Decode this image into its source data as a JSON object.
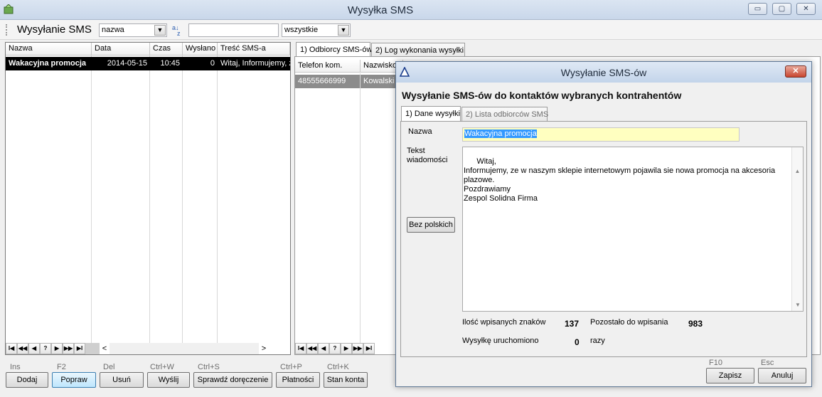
{
  "window": {
    "title": "Wysyłka SMS",
    "controls": {
      "minimize": "▭",
      "maximize": "▢",
      "close": "✕"
    }
  },
  "toolbar": {
    "title": "Wysyłanie SMS",
    "sort_field": "nazwa",
    "sort_icon": "a↓z sort-icon",
    "search_value": "",
    "filter": "wszystkie"
  },
  "left_grid": {
    "columns": [
      "Nazwa",
      "Data",
      "Czas",
      "Wysłano",
      "Treść SMS-a"
    ],
    "rows": [
      {
        "nazwa": "Wakacyjna promocja",
        "data": "2014-05-15",
        "czas": "10:45",
        "wyslano": "0",
        "tresc": "Witaj, Informujemy, ze"
      }
    ]
  },
  "right_panel": {
    "tabs": [
      "1) Odbiorcy SMS-ów",
      "2) Log wykonania wysyłki"
    ],
    "columns": [
      "Telefon kom.",
      "Nazwisko"
    ],
    "rows": [
      {
        "telefon": "48555666999",
        "nazwisko": "Kowalski"
      }
    ]
  },
  "nav": {
    "buttons": [
      "I◀",
      "◀◀",
      "◀",
      "?",
      "▶",
      "▶▶",
      "▶I"
    ],
    "left": "<",
    "right": ">"
  },
  "bottom_buttons": [
    {
      "key": "Ins",
      "label": "Dodaj"
    },
    {
      "key": "F2",
      "label": "Popraw"
    },
    {
      "key": "Del",
      "label": "Usuń"
    },
    {
      "key": "Ctrl+W",
      "label": "Wyślij"
    },
    {
      "key": "Ctrl+S",
      "label": "Sprawdź doręczenie"
    },
    {
      "key": "Ctrl+P",
      "label": "Płatności"
    },
    {
      "key": "Ctrl+K",
      "label": "Stan konta"
    }
  ],
  "dialog": {
    "title": "Wysyłanie SMS-ów",
    "heading": "Wysyłanie SMS-ów do kontaktów wybranych kontrahentów",
    "tabs": [
      "1) Dane wysyłki",
      "2) Lista odbiorców SMS"
    ],
    "name_label": "Nazwa",
    "name_value": "Wakacyjna promocja",
    "text_label": "Tekst wiadomości",
    "message": "Witaj,\nInformujemy, ze w naszym sklepie internetowym pojawila sie nowa promocja na akcesoria plazowe.\nPozdrawiamy\nZespol Solidna Firma",
    "no_polish_button": "Bez polskich",
    "chars_label": "Ilość wpisanych znaków",
    "chars_value": "137",
    "remaining_label": "Pozostało do wpisania",
    "remaining_value": "983",
    "runs_label": "Wysyłkę uruchomiono",
    "runs_value": "0",
    "runs_unit": "razy",
    "save_key": "F10",
    "save_label": "Zapisz",
    "cancel_key": "Esc",
    "cancel_label": "Anuluj"
  }
}
